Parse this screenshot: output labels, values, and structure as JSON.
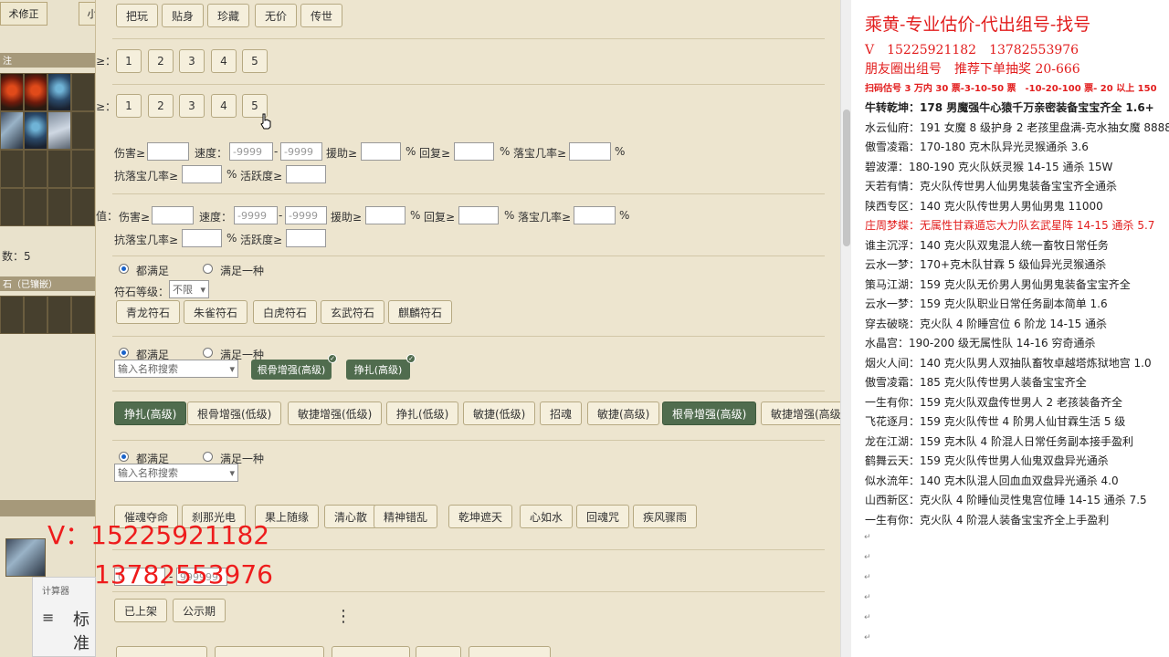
{
  "left_panel": {
    "tab_1": "术修正",
    "tab_2": "小",
    "bar_1": "注",
    "count_text": "数：5",
    "bar_2": "石（已镶嵌）"
  },
  "calculator": {
    "title": "计算器",
    "mode": "标准"
  },
  "quality_buttons": [
    "把玩",
    "贴身",
    "珍藏",
    "无价",
    "传世"
  ],
  "level_row_1": {
    "label": "≥：",
    "values": [
      "1",
      "2",
      "3",
      "4",
      "5"
    ]
  },
  "level_row_2": {
    "label": "≥：",
    "values": [
      "1",
      "2",
      "3",
      "4",
      "5"
    ]
  },
  "filter_1": {
    "dmg": "伤害≥",
    "speed": "速度：",
    "speed_min": "-9999",
    "dash": "-",
    "speed_max": "-9999",
    "aid": "援助≥",
    "pct": "%",
    "recover": "回复≥",
    "drop": "落宝几率≥",
    "resist_drop": "抗落宝几率≥",
    "active": "活跃度≥"
  },
  "filter_2": {
    "prefix": "值：",
    "dmg": "伤害≥",
    "speed": "速度：",
    "speed_min": "-9999",
    "dash": "-",
    "speed_max": "-9999",
    "aid": "援助≥",
    "pct": "%",
    "recover": "回复≥",
    "drop": "落宝几率≥",
    "resist_drop": "抗落宝几率≥",
    "active": "活跃度≥"
  },
  "radio_all": "都满足",
  "radio_one": "满足一种",
  "rune": {
    "label": "符石等级：",
    "select_value": "不限",
    "buttons": [
      "青龙符石",
      "朱雀符石",
      "白虎符石",
      "玄武符石",
      "麒麟符石"
    ]
  },
  "search_placeholder": "输入名称搜索",
  "selected_tags": [
    "根骨增强(高级)",
    "挣扎(高级)"
  ],
  "skill_buttons": [
    "挣扎(高级)",
    "根骨增强(低级)",
    "敏捷增强(低级)",
    "挣扎(低级)",
    "敏捷(低级)",
    "招魂",
    "敏捷(高级)",
    "根骨增强(高级)",
    "敏捷增强(高级"
  ],
  "skill_buttons_dark": [
    true,
    false,
    false,
    false,
    false,
    false,
    false,
    true,
    false
  ],
  "special_buttons": [
    "催魂夺命",
    "刹那光电",
    "果上随缘",
    "清心散",
    "精神错乱",
    "乾坤遮天",
    "心如水",
    "回魂咒",
    "疾风骤雨"
  ],
  "price_inputs": {
    "min": "0",
    "dash": "-",
    "max": "999999"
  },
  "status_buttons": {
    "listed": "已上架",
    "public": "公示期",
    "more": "⋮"
  },
  "overlay": {
    "v_line": "V：15225921182",
    "v_line2": "13782553976"
  },
  "right_panel": {
    "title": "乘黄-专业估价-代出组号-找号",
    "phone": "V　15225921182　13782553976",
    "promo": "朋友圈出组号　推荐下单抽奖 20-666",
    "price_line": "扫码估号 3 万内 30 票-3-10-50 票　-10-20-100 票- 20 以上 150",
    "listings": [
      {
        "name": "牛转乾坤：",
        "desc": "178 男魔强牛心猿千万亲密装备宝宝齐全 1.6+",
        "bold": true,
        "red": false
      },
      {
        "name": "水云仙府：",
        "desc": "191 女魔 8 级护身 2 老孩里盘满-克水抽女魔 8888",
        "bold": false,
        "red": false
      },
      {
        "name": "傲雪凌霜：",
        "desc": "170-180 克木队异光灵猴通杀 3.6",
        "bold": false,
        "red": false
      },
      {
        "name": "碧波潭：",
        "desc": "180-190 克火队妖灵猴 14-15 通杀 15W",
        "bold": false,
        "red": false
      },
      {
        "name": "天若有情：",
        "desc": "克火队传世男人仙男鬼装备宝宝齐全通杀",
        "bold": false,
        "red": false
      },
      {
        "name": "陕西专区：",
        "desc": "140 克火队传世男人男仙男鬼 11000",
        "bold": false,
        "red": false
      },
      {
        "name": "庄周梦蝶：",
        "desc": "无属性甘霖遁忘大力队玄武星阵 14-15 通杀 5.7",
        "bold": false,
        "red": true
      },
      {
        "name": "谁主沉浮：",
        "desc": "140 克火队双鬼混人统一畜牧日常任务",
        "bold": false,
        "red": false
      },
      {
        "name": "云水一梦：",
        "desc": "170+克木队甘霖 5 级仙异光灵猴通杀",
        "bold": false,
        "red": false
      },
      {
        "name": "策马江湖：",
        "desc": "159 克火队无价男人男仙男鬼装备宝宝齐全",
        "bold": false,
        "red": false
      },
      {
        "name": "云水一梦：",
        "desc": "159 克火队职业日常任务副本简单 1.6",
        "bold": false,
        "red": false
      },
      {
        "name": "穿去破晓：",
        "desc": "克火队 4 阶睡宫位 6 阶龙 14-15 通杀",
        "bold": false,
        "red": false
      },
      {
        "name": "水晶宫：",
        "desc": "190-200 级无属性队 14-16 穷奇通杀",
        "bold": false,
        "red": false
      },
      {
        "name": "烟火人间：",
        "desc": "140 克火队男人双抽队畜牧卓越塔炼狱地宫 1.0",
        "bold": false,
        "red": false
      },
      {
        "name": "傲雪凌霜：",
        "desc": "185 克火队传世男人装备宝宝齐全",
        "bold": false,
        "red": false
      },
      {
        "name": "一生有你：",
        "desc": "159 克火队双盘传世男人 2 老孩装备齐全",
        "bold": false,
        "red": false
      },
      {
        "name": "飞花逐月：",
        "desc": "159 克火队传世 4 阶男人仙甘霖生活 5 级",
        "bold": false,
        "red": false
      },
      {
        "name": "龙在江湖：",
        "desc": "159 克木队 4 阶混人日常任务副本接手盈利",
        "bold": false,
        "red": false
      },
      {
        "name": "鹤舞云天：",
        "desc": "159 克火队传世男人仙鬼双盘异光通杀",
        "bold": false,
        "red": false
      },
      {
        "name": "似水流年：",
        "desc": "140 克木队混人回血血双盘异光通杀 4.0",
        "bold": false,
        "red": false
      },
      {
        "name": "山西新区：",
        "desc": "克火队 4 阶睡仙灵性鬼宫位睡 14-15 通杀 7.5",
        "bold": false,
        "red": false
      },
      {
        "name": "一生有你：",
        "desc": "克火队 4 阶混人装备宝宝齐全上手盈利",
        "bold": false,
        "red": false
      }
    ],
    "return_mark": "↵"
  }
}
